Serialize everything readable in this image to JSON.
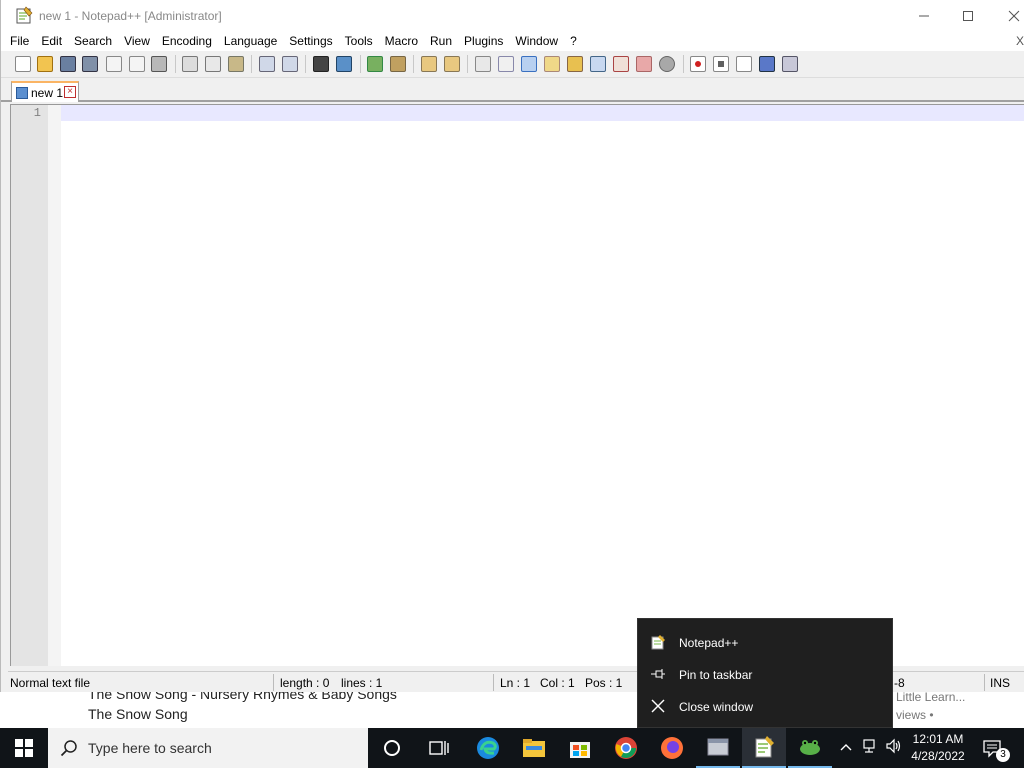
{
  "window": {
    "title": "new 1 - Notepad++ [Administrator]"
  },
  "menu": {
    "items": [
      "File",
      "Edit",
      "Search",
      "View",
      "Encoding",
      "Language",
      "Settings",
      "Tools",
      "Macro",
      "Run",
      "Plugins",
      "Window",
      "?"
    ],
    "extra_close": "X"
  },
  "tabs": [
    {
      "label": "new 1",
      "active": true
    }
  ],
  "editor": {
    "line_numbers": [
      "1"
    ],
    "content": ""
  },
  "statusbar": {
    "file_type": "Normal text file",
    "length": "length : 0",
    "lines": "lines : 1",
    "ln": "Ln : 1",
    "col": "Col : 1",
    "pos": "Pos : 1",
    "encoding_partial": "-8",
    "mode": "INS"
  },
  "background_page": {
    "song_title_1": "The Snow Song  - Nursery Rhymes & Baby Songs",
    "song_title_2": "The Snow Song",
    "meta_1": "Little Learn...",
    "meta_2": "views •"
  },
  "jumplist": {
    "items": [
      {
        "label": "Notepad++",
        "icon": "notepadpp-icon"
      },
      {
        "label": "Pin to taskbar",
        "icon": "pin-icon"
      },
      {
        "label": "Close window",
        "icon": "close-icon"
      }
    ]
  },
  "taskbar": {
    "search_placeholder": "Type here to search",
    "apps": [
      "cortana",
      "task-view",
      "edge",
      "file-explorer",
      "microsoft-store",
      "chrome",
      "firefox",
      "app-generic",
      "notepadpp",
      "app-frog"
    ],
    "clock_time": "12:01 AM",
    "clock_date": "4/28/2022",
    "notification_count": "3"
  },
  "colors": {
    "accent": "#76b9ed",
    "current_line": "#e8e8ff",
    "taskbar": "#101418",
    "jumplist": "#1f1f1f"
  }
}
